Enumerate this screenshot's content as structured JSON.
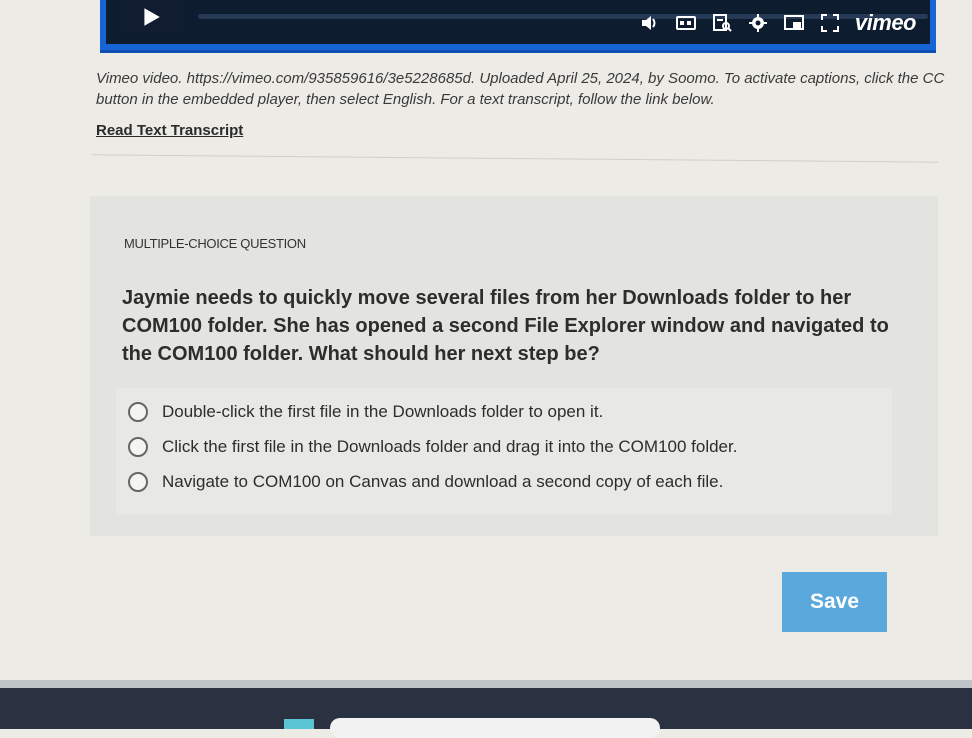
{
  "player": {
    "brand": "vimeo",
    "icons": [
      "play-icon",
      "volume-icon",
      "closed-captions-icon",
      "transcript-icon",
      "settings-icon",
      "picture-in-picture-icon",
      "fullscreen-icon"
    ],
    "accent_color": "#1664d6"
  },
  "caption": "Vimeo video. https://vimeo.com/935859616/3e5228685d. Uploaded April 25, 2024, by Soomo. To activate captions, click the CC button in the embedded player, then select English. For a text transcript, follow the link below.",
  "transcript_link": "Read Text Transcript",
  "question": {
    "label": "MULTIPLE-CHOICE QUESTION",
    "text": "Jaymie needs to quickly move several files from her Downloads folder to her COM100 folder. She has opened a second File Explorer window and navigated to the COM100 folder. What should her next step be?",
    "choices": [
      "Double-click the first file in the Downloads folder to open it.",
      "Click the first file in the Downloads folder and drag it into the COM100 folder.",
      "Navigate to COM100 on Canvas and download a second copy of each file."
    ]
  },
  "save_label": "Save",
  "save_color": "#5ba8dd"
}
